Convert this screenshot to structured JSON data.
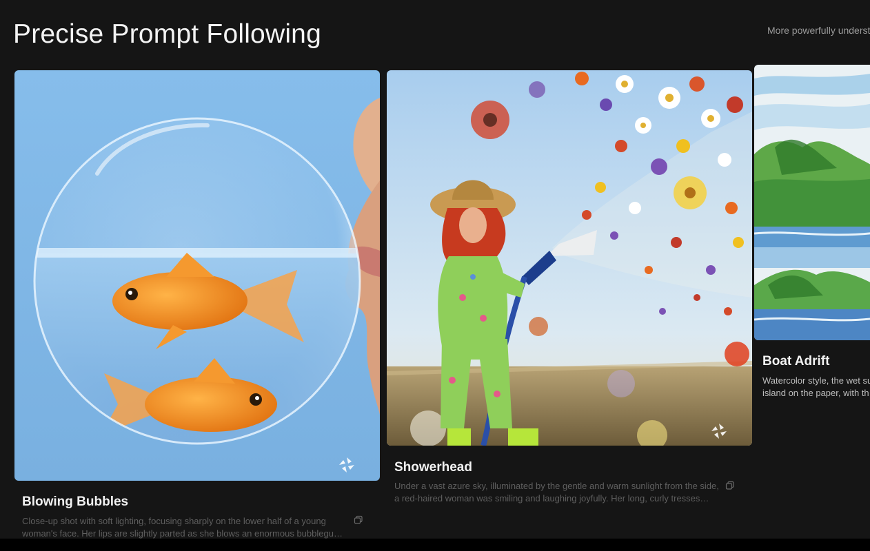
{
  "section": {
    "title": "Precise Prompt Following",
    "subtitle": "More powerfully understa"
  },
  "cards": [
    {
      "title": "Blowing Bubbles",
      "desc_line1": "Close-up shot with soft lighting, focusing sharply on the lower half of a young",
      "desc_line2": "woman's face. Her lips are slightly parted as she blows an enormous bubblegum…",
      "image_icon": "goldfish-bubble-image",
      "colors": {
        "sky": "#7fb6e6",
        "fish": "#f08a1e"
      }
    },
    {
      "title": "Showerhead",
      "desc_line1": "Under a vast azure sky, illuminated by the gentle and warm sunlight from the side,",
      "desc_line2": "a red-haired woman was smiling and laughing joyfully. Her long, curly tresses…",
      "image_icon": "flower-hose-image",
      "colors": {
        "sky": "#bcd9f2",
        "suit": "#8fcf5a",
        "hair": "#d8452a"
      }
    },
    {
      "title": "Boat Adrift",
      "desc_line1": "Watercolor style, the wet su",
      "desc_line2": "island on the paper, with th",
      "image_icon": "watercolor-island-image",
      "colors": {
        "water": "#6aa3d6",
        "hills": "#4c9a3a"
      }
    }
  ]
}
